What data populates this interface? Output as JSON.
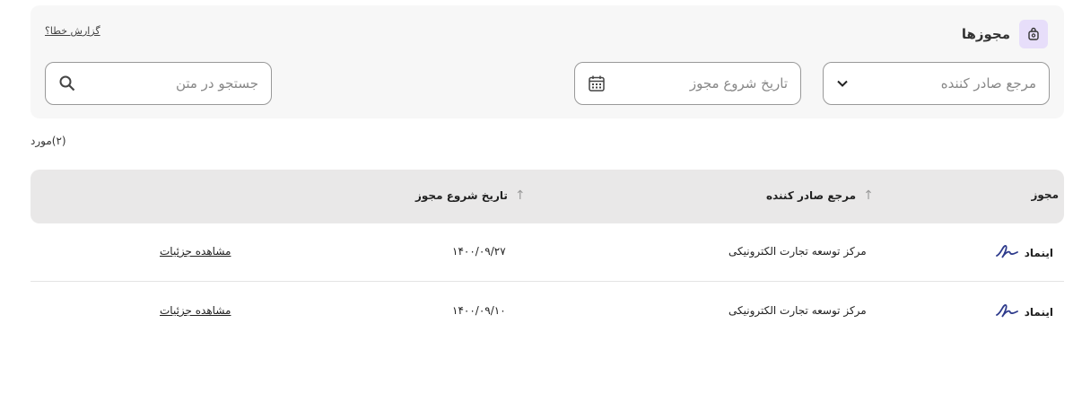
{
  "panel": {
    "title": "مجوزها",
    "report_link": "گزارش خطا؟"
  },
  "filters": {
    "issuer_placeholder": "مرجع صادر کننده",
    "date_placeholder": "تاریخ شروع مجوز",
    "search_placeholder": "جستجو در متن"
  },
  "count": "(۲)مورد",
  "table": {
    "headers": {
      "license": "مجوز",
      "issuer": "مرجع صادر کننده",
      "start_date": "تاریخ شروع مجوز"
    },
    "rows": [
      {
        "name": "اینماد",
        "issuer": "مرکز توسعه تجارت الکترونیکی",
        "date": "۱۴۰۰/۰۹/۲۷",
        "action": "مشاهده جزئیات"
      },
      {
        "name": "اینماد",
        "issuer": "مرکز توسعه تجارت الکترونیکی",
        "date": "۱۴۰۰/۰۹/۱۰",
        "action": "مشاهده جزئیات"
      }
    ]
  },
  "colors": {
    "accent_badge": "#e7defa",
    "logo": "#2e3b8c"
  },
  "icons": {
    "panel": "license-badge-icon",
    "dropdown": "chevron-down-icon",
    "date": "calendar-icon",
    "search": "search-icon",
    "sort": "arrow-up-icon",
    "row_logo": "enamad-logo-icon"
  }
}
